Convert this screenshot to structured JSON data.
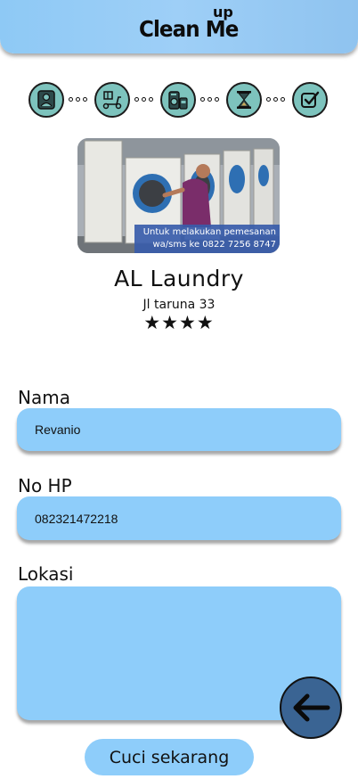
{
  "header": {
    "brand": "Clean Me",
    "brand_sup": "up",
    "bg_color": "#8ec9f5"
  },
  "steps": [
    {
      "icon": "user-profile-icon"
    },
    {
      "icon": "scooter-delivery-icon"
    },
    {
      "icon": "washing-machine-icon"
    },
    {
      "icon": "hourglass-icon"
    },
    {
      "icon": "checkbox-done-icon"
    }
  ],
  "shop": {
    "photo_caption_line1": "Untuk melakukan pemesanan",
    "photo_caption_line2": "wa/sms ke 0822 7256 8747",
    "name": "AL Laundry",
    "address": "Jl taruna 33",
    "rating_stars": "★★★★",
    "rating": 4
  },
  "form": {
    "name_label": "Nama",
    "name_value": "Revanio",
    "phone_label": "No HP",
    "phone_value": "082321472218",
    "location_label": "Lokasi",
    "location_value": "",
    "submit_label": "Cuci sekarang",
    "field_color": "#8ecdfa"
  },
  "nav": {
    "back_icon": "arrow-left-icon",
    "fab_color": "#3a6493"
  }
}
